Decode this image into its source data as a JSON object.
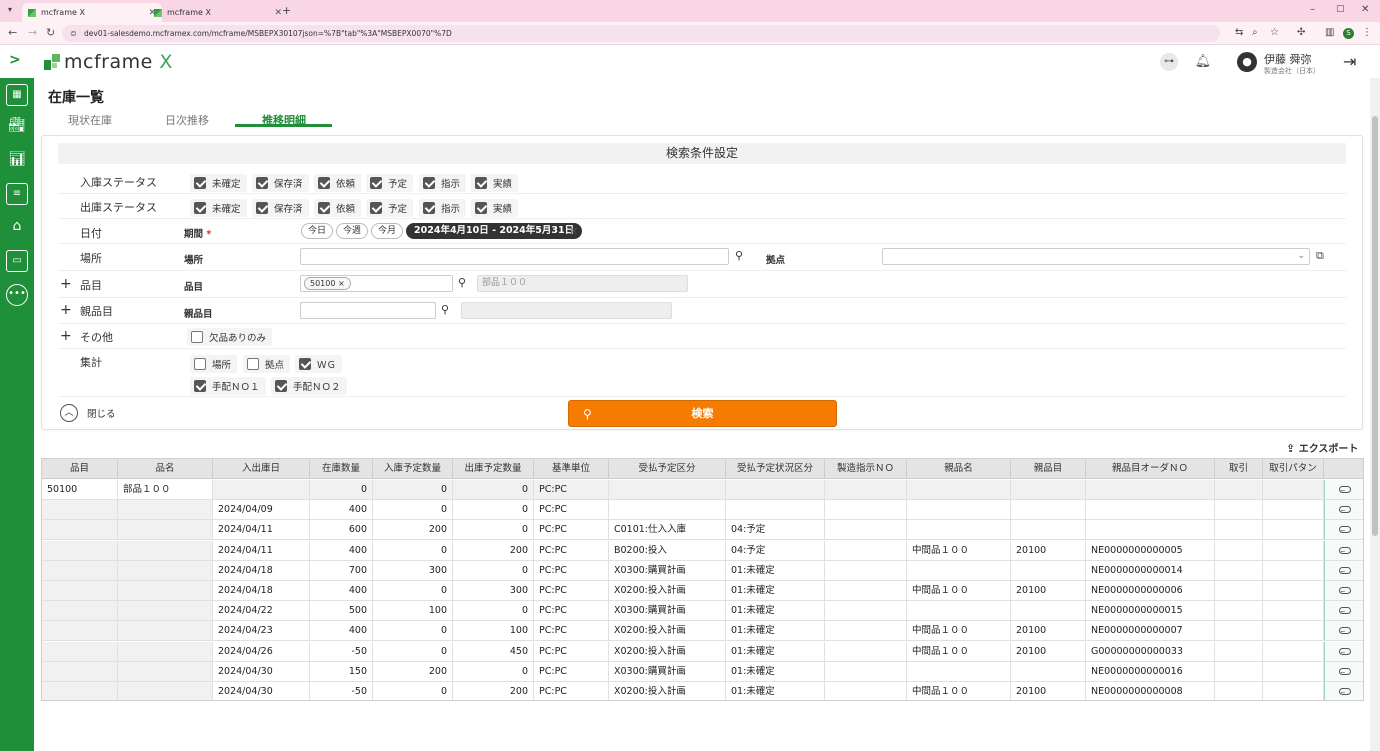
{
  "browser": {
    "tabs": [
      {
        "title": "mcframe X"
      },
      {
        "title": "mcframe X"
      }
    ],
    "url": "dev01-salesdemo.mcframex.com/mcframe/MSBEPX30107json=%7B\"tab\"%3A\"MSBEPX0070\"%7D"
  },
  "app": {
    "logo_text": "mcframe",
    "logo_x": "X",
    "user_name": "伊藤 舜弥",
    "user_company": "製造会社（日本）",
    "brand_color": "#1f8f3a",
    "accent_color": "#f57c00"
  },
  "sidebar_icons": [
    "calendar-icon",
    "factory-icon",
    "chart-icon",
    "document-icon",
    "warehouse-icon",
    "monitor-icon",
    "more-icon"
  ],
  "page": {
    "title": "在庫一覧",
    "tabs": [
      "現状在庫",
      "日次推移",
      "推移明細"
    ],
    "active_tab": "推移明細"
  },
  "search": {
    "title": "検索条件設定",
    "in_status_label": "入庫ステータス",
    "out_status_label": "出庫ステータス",
    "status_options": [
      "未確定",
      "保存済",
      "依頼",
      "予定",
      "指示",
      "実績"
    ],
    "date_label": "日付",
    "period_label": "期間",
    "required_mark": "*",
    "quick_periods": [
      "今日",
      "今週",
      "今月"
    ],
    "period_value": "2024年4月10日 - 2024年5月31日",
    "clear_mark": "×",
    "location_label": "場所",
    "location_sub": "場所",
    "site_label": "拠点",
    "item_label": "品目",
    "item_sub": "品目",
    "item_tag": "50100",
    "item_tag_x": "×",
    "item_name": "部品１００",
    "parent_label": "親品目",
    "parent_sub": "親品目",
    "other_label": "その他",
    "shortage_only": "欠品ありのみ",
    "agg_label": "集計",
    "agg_options": [
      {
        "label": "場所",
        "checked": false
      },
      {
        "label": "拠点",
        "checked": false
      },
      {
        "label": "ＷＧ",
        "checked": true
      },
      {
        "label": "手配ＮＯ１",
        "checked": true
      },
      {
        "label": "手配ＮＯ２",
        "checked": true
      }
    ],
    "close_label": "閉じる",
    "search_button": "検索",
    "export_label": "エクスポート"
  },
  "table": {
    "columns": [
      "品目",
      "品名",
      "入出庫日",
      "在庫数量",
      "入庫予定数量",
      "出庫予定数量",
      "基準単位",
      "受払予定区分",
      "受払予定状況区分",
      "製造指示ＮＯ",
      "親品名",
      "親品目",
      "親品目オーダＮＯ",
      "取引",
      "取引パタン"
    ],
    "rows": [
      [
        "50100",
        "部品１００",
        "",
        "0",
        "0",
        "0",
        "PC:PC",
        "",
        "",
        "",
        "",
        "",
        "",
        "",
        ""
      ],
      [
        "",
        "",
        "2024/04/09",
        "400",
        "0",
        "0",
        "PC:PC",
        "",
        "",
        "",
        "",
        "",
        "",
        "",
        ""
      ],
      [
        "",
        "",
        "2024/04/11",
        "600",
        "200",
        "0",
        "PC:PC",
        "C0101:仕入入庫",
        "04:予定",
        "",
        "",
        "",
        "",
        "",
        ""
      ],
      [
        "",
        "",
        "2024/04/11",
        "400",
        "0",
        "200",
        "PC:PC",
        "B0200:投入",
        "04:予定",
        "",
        "中間品１００",
        "20100",
        "NE0000000000005",
        "",
        ""
      ],
      [
        "",
        "",
        "2024/04/18",
        "700",
        "300",
        "0",
        "PC:PC",
        "X0300:購買計画",
        "01:未確定",
        "",
        "",
        "",
        "NE0000000000014",
        "",
        ""
      ],
      [
        "",
        "",
        "2024/04/18",
        "400",
        "0",
        "300",
        "PC:PC",
        "X0200:投入計画",
        "01:未確定",
        "",
        "中間品１００",
        "20100",
        "NE0000000000006",
        "",
        ""
      ],
      [
        "",
        "",
        "2024/04/22",
        "500",
        "100",
        "0",
        "PC:PC",
        "X0300:購買計画",
        "01:未確定",
        "",
        "",
        "",
        "NE0000000000015",
        "",
        ""
      ],
      [
        "",
        "",
        "2024/04/23",
        "400",
        "0",
        "100",
        "PC:PC",
        "X0200:投入計画",
        "01:未確定",
        "",
        "中間品１００",
        "20100",
        "NE0000000000007",
        "",
        ""
      ],
      [
        "",
        "",
        "2024/04/26",
        "-50",
        "0",
        "450",
        "PC:PC",
        "X0200:投入計画",
        "01:未確定",
        "",
        "中間品１００",
        "20100",
        "G00000000000033",
        "",
        ""
      ],
      [
        "",
        "",
        "2024/04/30",
        "150",
        "200",
        "0",
        "PC:PC",
        "X0300:購買計画",
        "01:未確定",
        "",
        "",
        "",
        "NE0000000000016",
        "",
        ""
      ],
      [
        "",
        "",
        "2024/04/30",
        "-50",
        "0",
        "200",
        "PC:PC",
        "X0200:投入計画",
        "01:未確定",
        "",
        "中間品１００",
        "20100",
        "NE0000000000008",
        "",
        ""
      ]
    ]
  }
}
